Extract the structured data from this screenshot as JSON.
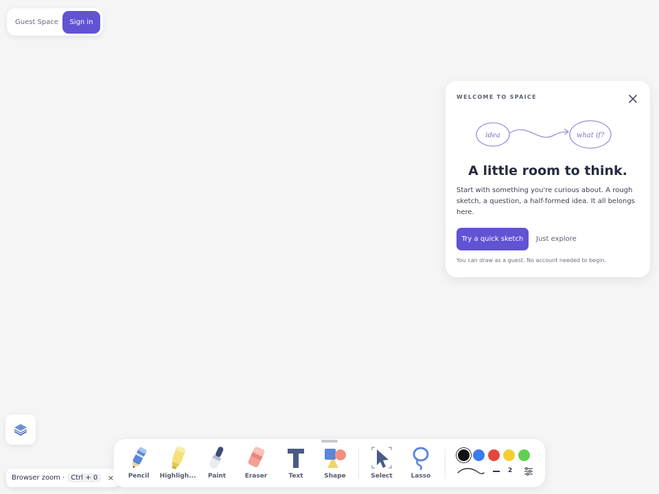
{
  "account": {
    "space_label": "Guest Space",
    "signin_label": "Sign in"
  },
  "welcome": {
    "eyebrow": "WELCOME TO SPAICE",
    "illustration": {
      "left_bubble": "idea",
      "right_bubble": "what if?"
    },
    "headline": "A little room to think.",
    "body": "Start with something you're curious about. A rough sketch, a question, a half-formed idea. It all belongs here.",
    "primary_label": "Try a quick sketch",
    "secondary_label": "Just explore",
    "fine_print": "You can draw as a guest. No account needed to begin."
  },
  "zoom_toast": {
    "label": "Browser zoom ·",
    "shortcut": "Ctrl + 0",
    "close": "×"
  },
  "toolbar": {
    "tools": [
      {
        "label": "Pencil",
        "icon": "pencil-icon"
      },
      {
        "label": "Highligh...",
        "icon": "highlighter-icon"
      },
      {
        "label": "Paint",
        "icon": "paint-brush-icon"
      },
      {
        "label": "Eraser",
        "icon": "eraser-icon"
      },
      {
        "label": "Text",
        "icon": "text-icon"
      },
      {
        "label": "Shape",
        "icon": "shape-icon"
      },
      {
        "label": "Select",
        "icon": "select-cursor-icon"
      },
      {
        "label": "Lasso",
        "icon": "lasso-icon"
      }
    ],
    "colors": [
      "#111111",
      "#3a7bef",
      "#e8453c",
      "#f4cf2e",
      "#5ed04e"
    ],
    "selected_color": "#111111",
    "stroke_width": "2"
  },
  "theme": {
    "accent": "#6153d4"
  }
}
